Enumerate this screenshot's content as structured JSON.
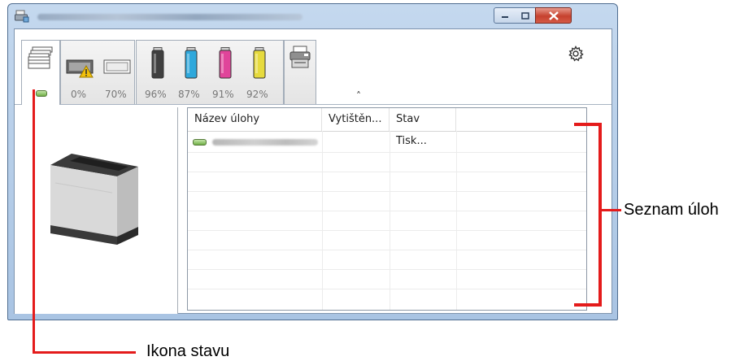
{
  "window": {
    "title_obscured": true,
    "controls": {
      "minimize": "minimize",
      "maximize": "maximize",
      "close": "close"
    }
  },
  "tabs": [
    {
      "id": "job-list",
      "icon": "document-stack-icon",
      "active": true
    },
    {
      "id": "paper",
      "icon": "paper-tray-icon",
      "levels": [
        "0%",
        "70%"
      ],
      "warning": true
    },
    {
      "id": "toner",
      "icon": "toner-cartridge-icon",
      "levels": [
        "96%",
        "87%",
        "91%",
        "92%"
      ],
      "colors": [
        "#3f3f3f",
        "#2ea8dc",
        "#e0449a",
        "#e6da3d"
      ]
    },
    {
      "id": "device",
      "icon": "printer-device-icon"
    }
  ],
  "list": {
    "columns": [
      "Název úlohy",
      "Vytištěn...",
      "Stav"
    ],
    "rows": [
      {
        "name_obscured": true,
        "printed": "",
        "status": "Tisk..."
      }
    ]
  },
  "annotations": {
    "job_list": "Seznam úloh",
    "status_icon": "Ikona stavu",
    "color": "#e41b1b"
  }
}
